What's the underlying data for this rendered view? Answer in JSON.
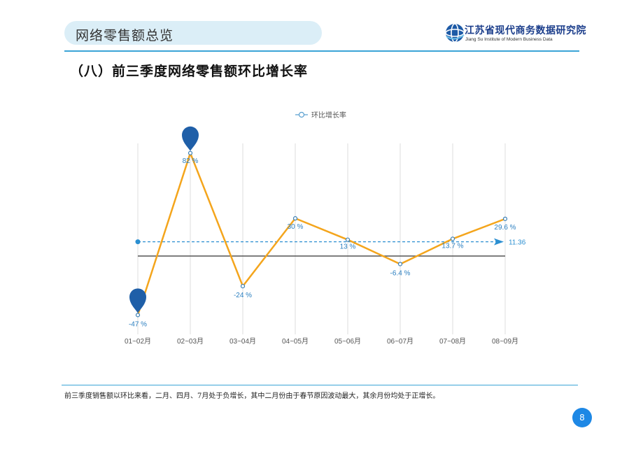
{
  "header": {
    "title": "网络零售额总览",
    "logo_cn": "江苏省现代商务数据研究院",
    "logo_en": "Jiang Su Institute of Modern Business Data"
  },
  "section_title": "（八）前三季度网络零售额环比增长率",
  "chart_data": {
    "type": "line",
    "categories": [
      "01~02月",
      "02~03月",
      "03~04月",
      "04~05月",
      "05~06月",
      "06~07月",
      "07~08月",
      "08~09月"
    ],
    "series": [
      {
        "name": "环比增长率",
        "values": [
          -47,
          82,
          -24,
          30,
          13,
          -6.4,
          13.7,
          29.6
        ],
        "labels": [
          "-47 %",
          "82 %",
          "-24 %",
          "30 %",
          "13 %",
          "-6.4 %",
          "13.7 %",
          "29.6 %"
        ],
        "color": "#f4a51c"
      }
    ],
    "average": {
      "value": 11.36,
      "label": "11.36",
      "color": "#2b8fd1"
    },
    "markers": {
      "max": {
        "category": "02~03月",
        "value": 82
      },
      "min": {
        "category": "01~02月",
        "value": -47
      }
    },
    "ylim": [
      -55,
      95
    ],
    "legend": "top-center",
    "grid": "vertical"
  },
  "footer": {
    "note": "前三季度销售额以环比来看，二月、四月、7月处于负增长，其中二月份由于春节原因波动最大，其余月份均处于正增长。",
    "page": "8"
  },
  "colors": {
    "accent": "#3ba4d6",
    "marker": "#1f5fa8",
    "badge": "#1e88e5"
  }
}
